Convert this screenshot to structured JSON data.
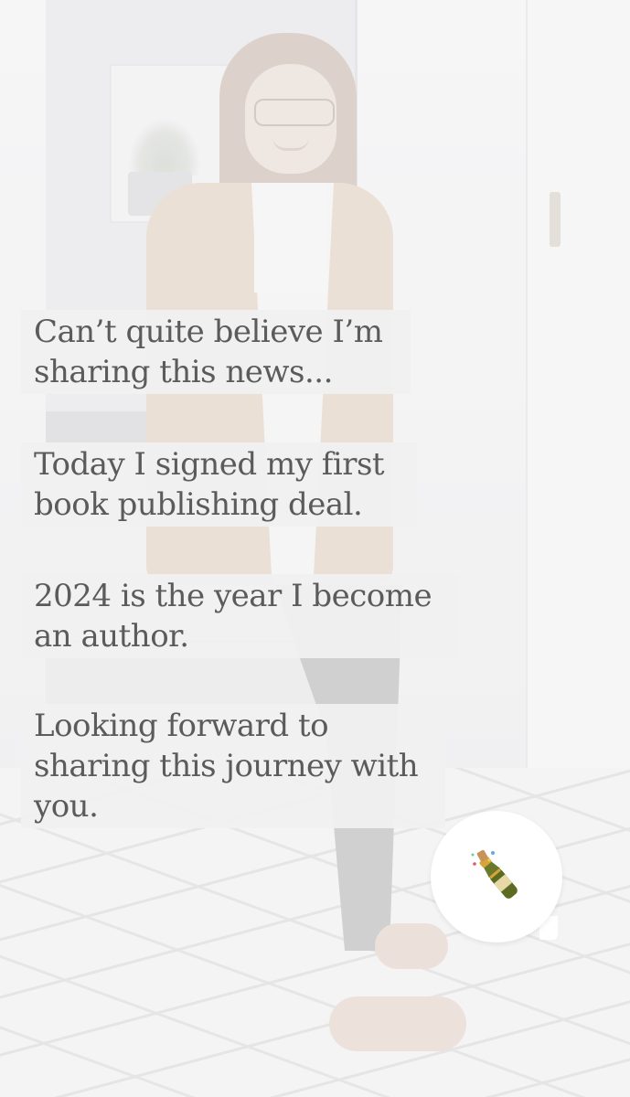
{
  "story": {
    "captions": [
      {
        "lines": [
          "Can’t quite believe I’m",
          "sharing this news..."
        ]
      },
      {
        "lines": [
          "Today I signed my first",
          "book publishing deal."
        ]
      },
      {
        "lines": [
          "2024 is the year I become",
          "an author."
        ]
      },
      {
        "lines": [
          "Looking forward to",
          "sharing this journey with",
          "you."
        ]
      }
    ],
    "reaction": {
      "icon": "champagne-bottle-icon"
    }
  },
  "colors": {
    "caption_background": "#f0f0f0",
    "caption_text": "#5b5b5b",
    "reaction_background": "#ffffff"
  }
}
